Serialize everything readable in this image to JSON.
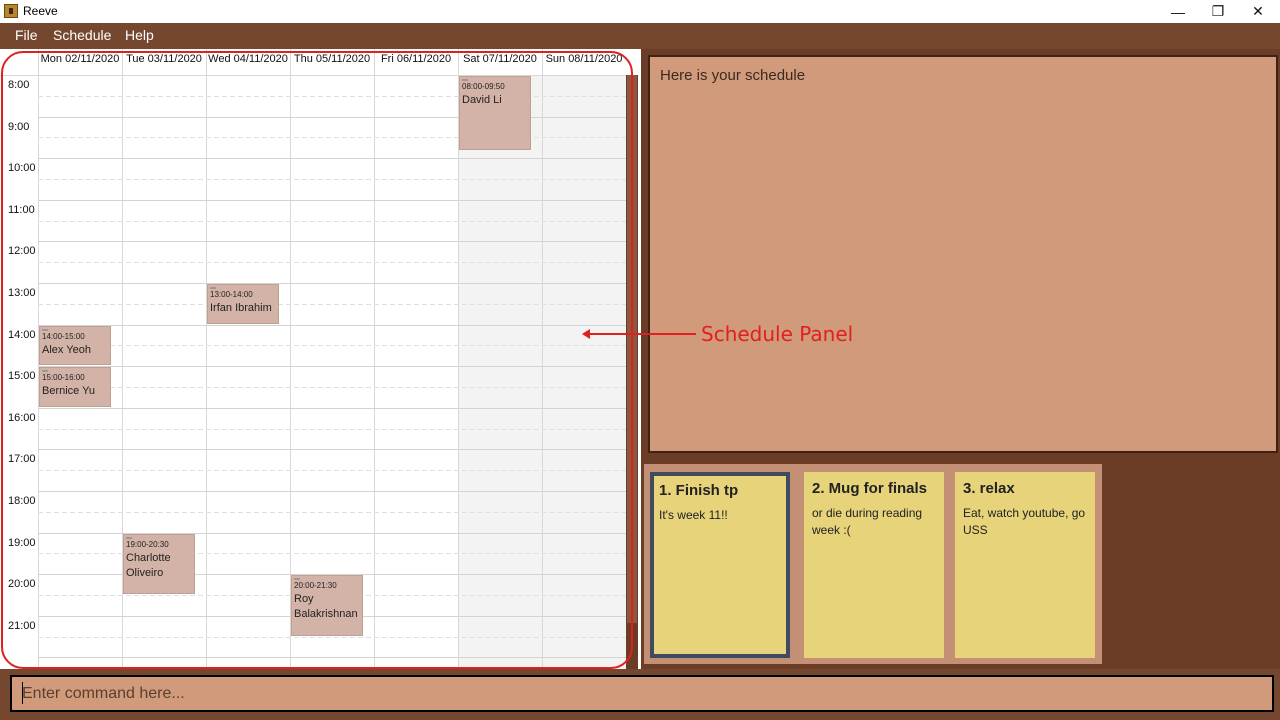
{
  "window": {
    "title": "Reeve",
    "minimize_glyph": "—",
    "restore_glyph": "❐",
    "close_glyph": "✕"
  },
  "menu": [
    "File",
    "Schedule",
    "Help"
  ],
  "schedule": {
    "days": [
      "Mon 02/11/2020",
      "Tue 03/11/2020",
      "Wed 04/11/2020",
      "Thu 05/11/2020",
      "Fri 06/11/2020",
      "Sat 07/11/2020",
      "Sun 08/11/2020"
    ],
    "times": [
      "8:00",
      "9:00",
      "10:00",
      "11:00",
      "12:00",
      "13:00",
      "14:00",
      "15:00",
      "16:00",
      "17:00",
      "18:00",
      "19:00",
      "20:00",
      "21:00"
    ],
    "events": [
      {
        "day": "Sat 07/11/2020",
        "start": "08:00",
        "end": "09:50",
        "time": "08:00-09:50",
        "name": "David Li"
      },
      {
        "day": "Wed 04/11/2020",
        "start": "13:00",
        "end": "14:00",
        "time": "13:00-14:00",
        "name": "Irfan Ibrahim"
      },
      {
        "day": "Mon 02/11/2020",
        "start": "14:00",
        "end": "15:00",
        "time": "14:00-15:00",
        "name": "Alex Yeoh"
      },
      {
        "day": "Mon 02/11/2020",
        "start": "15:00",
        "end": "16:00",
        "time": "15:00-16:00",
        "name": "Bernice Yu"
      },
      {
        "day": "Tue 03/11/2020",
        "start": "19:00",
        "end": "20:30",
        "time": "19:00-20:30",
        "name": "Charlotte Oliveiro"
      },
      {
        "day": "Thu 05/11/2020",
        "start": "20:00",
        "end": "21:30",
        "time": "20:00-21:30",
        "name": "Roy Balakrishnan"
      }
    ]
  },
  "result_panel": {
    "message": "Here is your schedule"
  },
  "notes": [
    {
      "title": "1. Finish tp",
      "body": "It's week 11!!"
    },
    {
      "title": "2. Mug for finals",
      "body": "or die during reading week :("
    },
    {
      "title": "3. relax",
      "body": "Eat, watch youtube, go USS"
    }
  ],
  "command_box": {
    "placeholder": "Enter command here..."
  },
  "annotation": {
    "label": "Schedule Panel"
  },
  "colors": {
    "event_bg": "#d3b3a7",
    "note_bg": "#e6d37a",
    "annotation": "#e02020",
    "panel_bg": "#d19a7a"
  }
}
